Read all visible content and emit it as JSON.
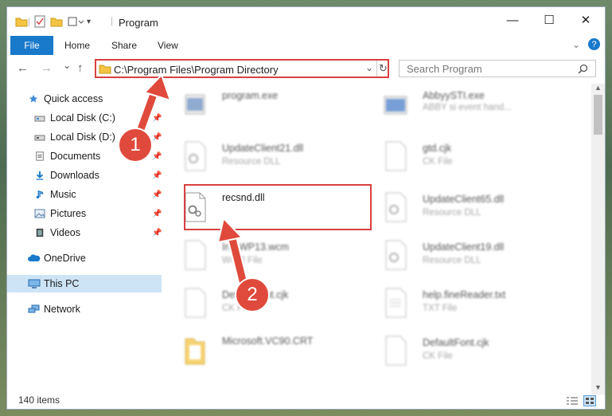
{
  "window": {
    "title": "Program",
    "minimize": "—",
    "maximize": "☐",
    "close": "✕"
  },
  "ribbon": {
    "tabs": [
      "File",
      "Home",
      "Share",
      "View"
    ],
    "help": "?"
  },
  "nav": {
    "back": "←",
    "forward": "→",
    "recent": "⌄",
    "up": "↑",
    "address": "C:\\Program Files\\Program Directory",
    "search_placeholder": "Search Program"
  },
  "sidebar": {
    "items": [
      {
        "label": "Quick access",
        "icon": "star-icon",
        "pinned": false
      },
      {
        "label": "Local Disk (C:)",
        "icon": "drive-icon",
        "pinned": true
      },
      {
        "label": "Local Disk (D:)",
        "icon": "drive-icon",
        "pinned": true
      },
      {
        "label": "Documents",
        "icon": "documents-icon",
        "pinned": true
      },
      {
        "label": "Downloads",
        "icon": "download-icon",
        "pinned": true
      },
      {
        "label": "Music",
        "icon": "music-icon",
        "pinned": true
      },
      {
        "label": "Pictures",
        "icon": "pictures-icon",
        "pinned": true
      },
      {
        "label": "Videos",
        "icon": "videos-icon",
        "pinned": true
      },
      {
        "label": "OneDrive",
        "icon": "cloud-icon",
        "pinned": false
      },
      {
        "label": "This PC",
        "icon": "computer-icon",
        "pinned": false,
        "selected": true
      },
      {
        "label": "Network",
        "icon": "network-icon",
        "pinned": false
      }
    ]
  },
  "files": [
    {
      "name": "program.exe",
      "type": "",
      "blurred": true
    },
    {
      "name": "AbbyySTI.exe",
      "type": "ABBY si event hand...",
      "blurred": true
    },
    {
      "name": "UpdateClient21.dll",
      "type": "Resource DLL",
      "blurred": true
    },
    {
      "name": "gtd.cjk",
      "type": "CK File",
      "blurred": true
    },
    {
      "name": "recsnd.dll",
      "type": "",
      "blurred": false
    },
    {
      "name": "UpdateClient65.dll",
      "type": "Resource DLL",
      "blurred": true
    },
    {
      "name": "InfoWP13.wcm",
      "type": "WCM File",
      "blurred": true
    },
    {
      "name": "UpdateClient19.dll",
      "type": "Resource DLL",
      "blurred": true
    },
    {
      "name": "DefaultFont.cjk",
      "type": "CK File",
      "blurred": true
    },
    {
      "name": "help.fineReader.txt",
      "type": "TXT File",
      "blurred": true
    },
    {
      "name": "Microsoft.VC90.CRT",
      "type": "",
      "blurred": true
    },
    {
      "name": "DefaultFont.cjk",
      "type": "CK File",
      "blurred": true
    }
  ],
  "status": {
    "count": "140 items"
  },
  "callouts": [
    "1",
    "2"
  ],
  "colors": {
    "accent": "#1979ca",
    "highlight": "#d94040",
    "selected": "#cde4f7"
  }
}
